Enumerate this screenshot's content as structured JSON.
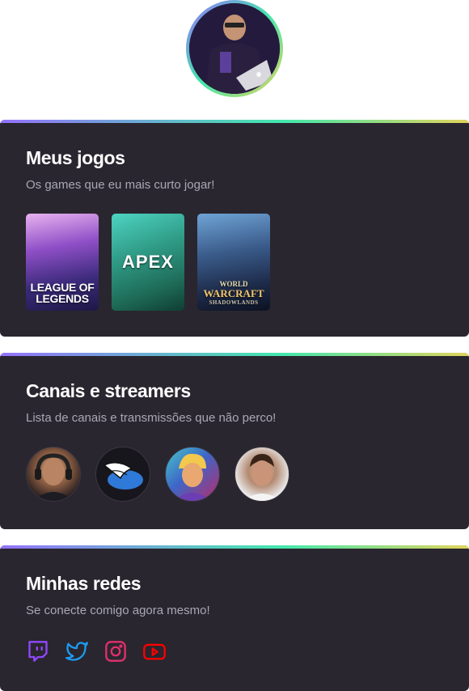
{
  "profile": {
    "avatar_icon": "profile-photo"
  },
  "games_card": {
    "title": "Meus jogos",
    "subtitle": "Os games que eu mais curto jogar!",
    "games": [
      {
        "title_line1": "LEAGUE OF",
        "title_line2": "LEGENDS"
      },
      {
        "title_line1": "APEX",
        "title_line2": ""
      },
      {
        "title_line1": "WORLD",
        "title_line2": "WARCRAFT",
        "subtitle": "SHADOWLANDS"
      }
    ]
  },
  "streamers_card": {
    "title": "Canais e streamers",
    "subtitle": "Lista de canais e transmissões que não perco!",
    "streamers": [
      "streamer-1",
      "streamer-2",
      "streamer-3",
      "streamer-4"
    ]
  },
  "social_card": {
    "title": "Minhas redes",
    "subtitle": "Se conecte comigo agora mesmo!",
    "networks": [
      {
        "icon": "twitch-icon",
        "color": "#9147ff"
      },
      {
        "icon": "twitter-icon",
        "color": "#1d9bf0"
      },
      {
        "icon": "instagram-icon",
        "color": "#e1306c"
      },
      {
        "icon": "youtube-icon",
        "color": "#ff0000"
      }
    ]
  },
  "colors": {
    "background": "#ffffff",
    "card": "#29262f",
    "title": "#ffffff",
    "subtitle": "#a8a8b3",
    "gradient": [
      "#9572fc",
      "#43e7ad",
      "#e2d45c"
    ]
  }
}
